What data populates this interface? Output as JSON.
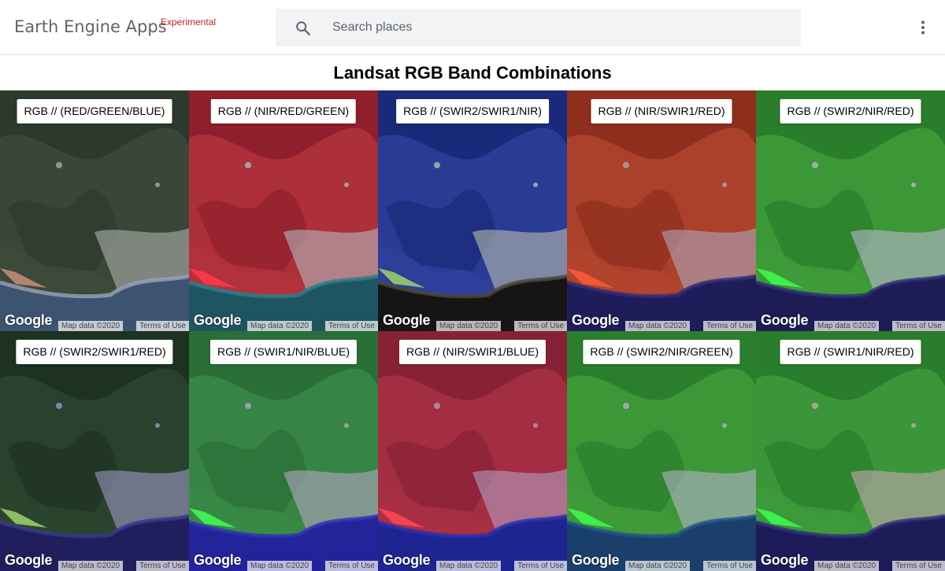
{
  "header": {
    "brand": "Earth Engine Apps",
    "brand_tag": "Experimental",
    "search_placeholder": "Search places",
    "search_icon": "search-icon",
    "menu_icon": "more-vert-icon"
  },
  "page_title": "Landsat RGB Band Combinations",
  "attribution": {
    "logo": "Google",
    "map_data": "Map data ©2020",
    "terms": "Terms of Use"
  },
  "panels": [
    {
      "label": "RGB // (RED/GREEN/BLUE)",
      "colors": {
        "land": "#3c4a3a",
        "vegetation": "#2b3a2c",
        "urban": "#b9b9b9",
        "water": "#3d5470",
        "coast": "#9aa3b8",
        "accent": "#c98f7a"
      }
    },
    {
      "label": "RGB // (NIR/RED/GREEN)",
      "colors": {
        "land": "#b3323d",
        "vegetation": "#8f1f2c",
        "urban": "#b6c4c9",
        "water": "#1f5560",
        "coast": "#2a7f8a",
        "accent": "#ff3b4e"
      }
    },
    {
      "label": "RGB // (SWIR2/SWIR1/NIR)",
      "colors": {
        "land": "#2d3f9a",
        "vegetation": "#1a2a7a",
        "urban": "#c9c9b0",
        "water": "#151515",
        "coast": "#4b4b38",
        "accent": "#9fd36b"
      }
    },
    {
      "label": "RGB // (NIR/SWIR1/RED)",
      "colors": {
        "land": "#b2442e",
        "vegetation": "#8e2f1e",
        "urban": "#aeb1c9",
        "water": "#1f1c5a",
        "coast": "#2e2b78",
        "accent": "#ff5a3a"
      }
    },
    {
      "label": "RGB // (SWIR2/NIR/RED)",
      "colors": {
        "land": "#3f9b3a",
        "vegetation": "#2a7d2a",
        "urban": "#c6b9e0",
        "water": "#1d1c55",
        "coast": "#2e2c78",
        "accent": "#3cff4e"
      }
    },
    {
      "label": "RGB // (SWIR2/SWIR1/RED)",
      "colors": {
        "land": "#2b452f",
        "vegetation": "#1e3222",
        "urban": "#a7a3d4",
        "water": "#201e5c",
        "coast": "#3a3a8a",
        "accent": "#9fd36b"
      }
    },
    {
      "label": "RGB // (SWIR1/NIR/BLUE)",
      "colors": {
        "land": "#3a8a47",
        "vegetation": "#2a6e38",
        "urban": "#c0a9cc",
        "water": "#23249a",
        "coast": "#2d31b6",
        "accent": "#43ff5b"
      }
    },
    {
      "label": "RGB // (NIR/SWIR1/BLUE)",
      "colors": {
        "land": "#a93043",
        "vegetation": "#872236",
        "urban": "#b4a7cf",
        "water": "#1e2590",
        "coast": "#2a30b0",
        "accent": "#ff4652"
      }
    },
    {
      "label": "RGB // (SWIR2/NIR/GREEN)",
      "colors": {
        "land": "#3f9b3a",
        "vegetation": "#2b7e2c",
        "urban": "#c1b4da",
        "water": "#1a3f6a",
        "coast": "#22528a",
        "accent": "#3cff4e"
      }
    },
    {
      "label": "RGB // (SWIR1/NIR/RED)",
      "colors": {
        "land": "#3e9a3c",
        "vegetation": "#2a7d2c",
        "urban": "#d4a9c0",
        "water": "#1e1c58",
        "coast": "#2f2d7a",
        "accent": "#3cff4e"
      }
    }
  ]
}
